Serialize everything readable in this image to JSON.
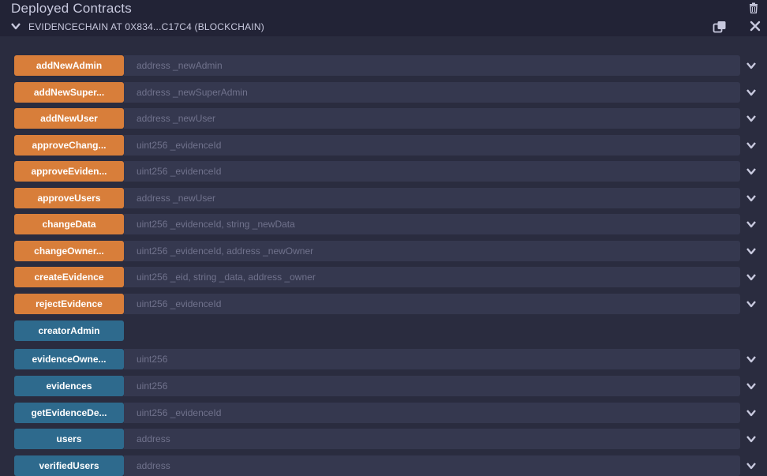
{
  "header": {
    "title": "Deployed Contracts",
    "icons": {
      "trash": "trash-icon"
    }
  },
  "instance": {
    "label": "EVIDENCECHAIN AT 0X834...C17C4 (BLOCKCHAIN)",
    "icons": {
      "chevron": "chevron-down-icon",
      "copy": "copy-icon",
      "close": "close-icon"
    }
  },
  "colors": {
    "transact_button": "#d87e3a",
    "call_button": "#2e6a8d",
    "input_background": "#35384f",
    "panel_background": "#2a2c3f"
  },
  "functions": [
    {
      "label": "addNewAdmin",
      "kind": "transact",
      "placeholder": "address _newAdmin"
    },
    {
      "label": "addNewSuper...",
      "kind": "transact",
      "placeholder": "address _newSuperAdmin"
    },
    {
      "label": "addNewUser",
      "kind": "transact",
      "placeholder": "address _newUser"
    },
    {
      "label": "approveChang...",
      "kind": "transact",
      "placeholder": "uint256 _evidenceId"
    },
    {
      "label": "approveEviden...",
      "kind": "transact",
      "placeholder": "uint256 _evidenceId"
    },
    {
      "label": "approveUsers",
      "kind": "transact",
      "placeholder": "address _newUser"
    },
    {
      "label": "changeData",
      "kind": "transact",
      "placeholder": "uint256 _evidenceId, string _newData"
    },
    {
      "label": "changeOwner...",
      "kind": "transact",
      "placeholder": "uint256 _evidenceId, address _newOwner"
    },
    {
      "label": "createEvidence",
      "kind": "transact",
      "placeholder": "uint256 _eid, string _data, address _owner"
    },
    {
      "label": "rejectEvidence",
      "kind": "transact",
      "placeholder": "uint256 _evidenceId"
    },
    {
      "label": "creatorAdmin",
      "kind": "call",
      "placeholder": null
    },
    {
      "label": "evidenceOwne...",
      "kind": "call",
      "placeholder": "uint256"
    },
    {
      "label": "evidences",
      "kind": "call",
      "placeholder": "uint256"
    },
    {
      "label": "getEvidenceDe...",
      "kind": "call",
      "placeholder": "uint256 _evidenceId"
    },
    {
      "label": "users",
      "kind": "call",
      "placeholder": "address"
    },
    {
      "label": "verifiedUsers",
      "kind": "call",
      "placeholder": "address"
    }
  ]
}
